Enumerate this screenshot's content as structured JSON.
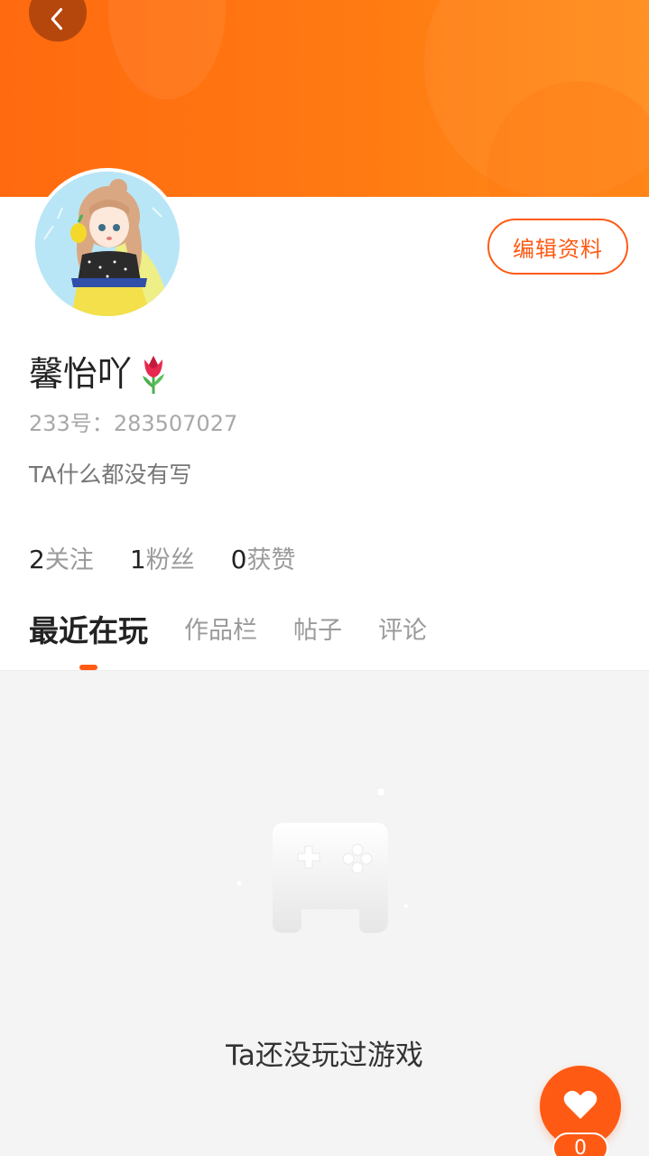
{
  "header": {
    "back_icon": "chevron-left-icon",
    "banner_color": "#ff7a12"
  },
  "profile": {
    "avatar_icon": "anime-girl-avatar",
    "nickname": "馨怡吖",
    "nickname_emoji_icon": "tulip-icon",
    "uid_label": "233号：",
    "uid_value": "283507027",
    "bio": "TA什么都没有写",
    "edit_button_label": "编辑资料"
  },
  "stats": [
    {
      "count": "2",
      "label": "关注"
    },
    {
      "count": "1",
      "label": "粉丝"
    },
    {
      "count": "0",
      "label": "获赞"
    }
  ],
  "tabs": [
    {
      "label": "最近在玩",
      "active": true
    },
    {
      "label": "作品栏",
      "active": false
    },
    {
      "label": "帖子",
      "active": false
    },
    {
      "label": "评论",
      "active": false
    }
  ],
  "empty_state": {
    "icon": "gamepad-icon",
    "text": "Ta还没玩过游戏"
  },
  "fab": {
    "icon": "heart-icon",
    "count": "0"
  },
  "colors": {
    "accent": "#ff5a14",
    "content_bg": "#f4f4f4"
  }
}
